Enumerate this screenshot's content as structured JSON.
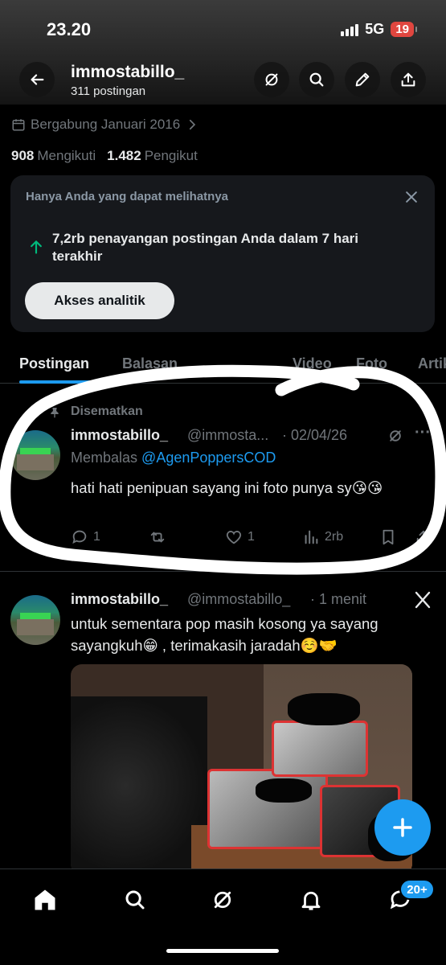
{
  "status_bar": {
    "time": "23.20",
    "network": "5G",
    "battery": "19"
  },
  "header": {
    "username": "immostabillo_",
    "post_count": "311 postingan"
  },
  "profile": {
    "joined": "Bergabung Januari 2016",
    "following_count": "908",
    "following_label": "Mengikuti",
    "followers_count": "1.482",
    "followers_label": "Pengikut"
  },
  "analytics_card": {
    "header": "Hanya Anda yang dapat melihatnya",
    "text": "7,2rb penayangan postingan Anda dalam 7 hari terakhir",
    "button": "Akses analitik"
  },
  "tabs": [
    {
      "label": "Postingan"
    },
    {
      "label": "Balasan"
    },
    {
      "label": "Video"
    },
    {
      "label": "Foto"
    },
    {
      "label": "Artikel"
    }
  ],
  "pinned_post": {
    "pinned_label": "Disematkan",
    "name": "immostabillo_",
    "handle": "@immosta...",
    "date": "· 02/04/26",
    "reply_prefix": "Membalas",
    "reply_to": "@AgenPoppersCOD",
    "text": "hati hati penipuan sayang ini foto punya sy😘😘",
    "replies": "1",
    "likes": "1",
    "views": "2rb"
  },
  "second_post": {
    "name": "immostabillo_",
    "handle": "@immostabillo_",
    "time": "· 1 menit",
    "text": "untuk sementara pop masih kosong ya sayang sayangkuh😁 , terimakasih jaradah☺️🤝"
  },
  "bottom_nav": {
    "notif_badge": "20+"
  },
  "colors": {
    "accent": "#1d9bf0",
    "background": "#000000",
    "card": "#16181c",
    "muted": "#71767b"
  }
}
